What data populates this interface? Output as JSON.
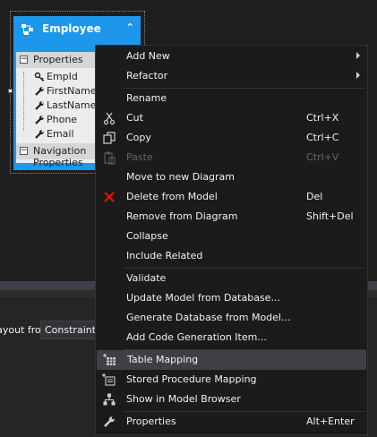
{
  "entity": {
    "title": "Employee",
    "collapse_glyph": "⌃",
    "properties_label": "Properties",
    "properties": [
      {
        "name": "EmpId",
        "icon": "key-icon"
      },
      {
        "name": "FirstName",
        "icon": "wrench-icon"
      },
      {
        "name": "LastName",
        "icon": "wrench-icon"
      },
      {
        "name": "Phone",
        "icon": "wrench-icon"
      },
      {
        "name": "Email",
        "icon": "wrench-icon"
      }
    ],
    "nav_label": "Navigation Properties",
    "expander_glyph": "−"
  },
  "layout": {
    "label": "Layout from:",
    "selected": "Constraint Violations"
  },
  "menu": {
    "items": [
      {
        "label": "Add New",
        "shortcut": "",
        "submenu": true
      },
      {
        "label": "Refactor",
        "shortcut": "",
        "submenu": true
      },
      {
        "label": "Rename",
        "shortcut": ""
      },
      {
        "label": "Cut",
        "shortcut": "Ctrl+X",
        "icon": "scissors-icon"
      },
      {
        "label": "Copy",
        "shortcut": "Ctrl+C",
        "icon": "copy-icon"
      },
      {
        "label": "Paste",
        "shortcut": "Ctrl+V",
        "icon": "paste-icon",
        "disabled": true
      },
      {
        "label": "Move to new Diagram",
        "shortcut": ""
      },
      {
        "label": "Delete from Model",
        "shortcut": "Del",
        "icon": "delete-icon"
      },
      {
        "label": "Remove from Diagram",
        "shortcut": "Shift+Del"
      },
      {
        "label": "Collapse",
        "shortcut": ""
      },
      {
        "label": "Include Related",
        "shortcut": ""
      },
      {
        "label": "Validate",
        "shortcut": ""
      },
      {
        "label": "Update Model from Database...",
        "shortcut": ""
      },
      {
        "label": "Generate Database from Model...",
        "shortcut": ""
      },
      {
        "label": "Add Code Generation Item...",
        "shortcut": ""
      },
      {
        "label": "Table Mapping",
        "shortcut": "",
        "icon": "table-mapping-icon",
        "highlighted": true
      },
      {
        "label": "Stored Procedure Mapping",
        "shortcut": "",
        "icon": "sproc-mapping-icon"
      },
      {
        "label": "Show in Model Browser",
        "shortcut": "",
        "icon": "model-browser-icon"
      },
      {
        "label": "Properties",
        "shortcut": "Alt+Enter",
        "icon": "wrench-icon"
      }
    ]
  },
  "colors": {
    "entity_header": "#1c97ea",
    "menu_bg": "#1b1b1c",
    "menu_highlight": "#3f3f46",
    "delete_icon": "#e51400"
  }
}
